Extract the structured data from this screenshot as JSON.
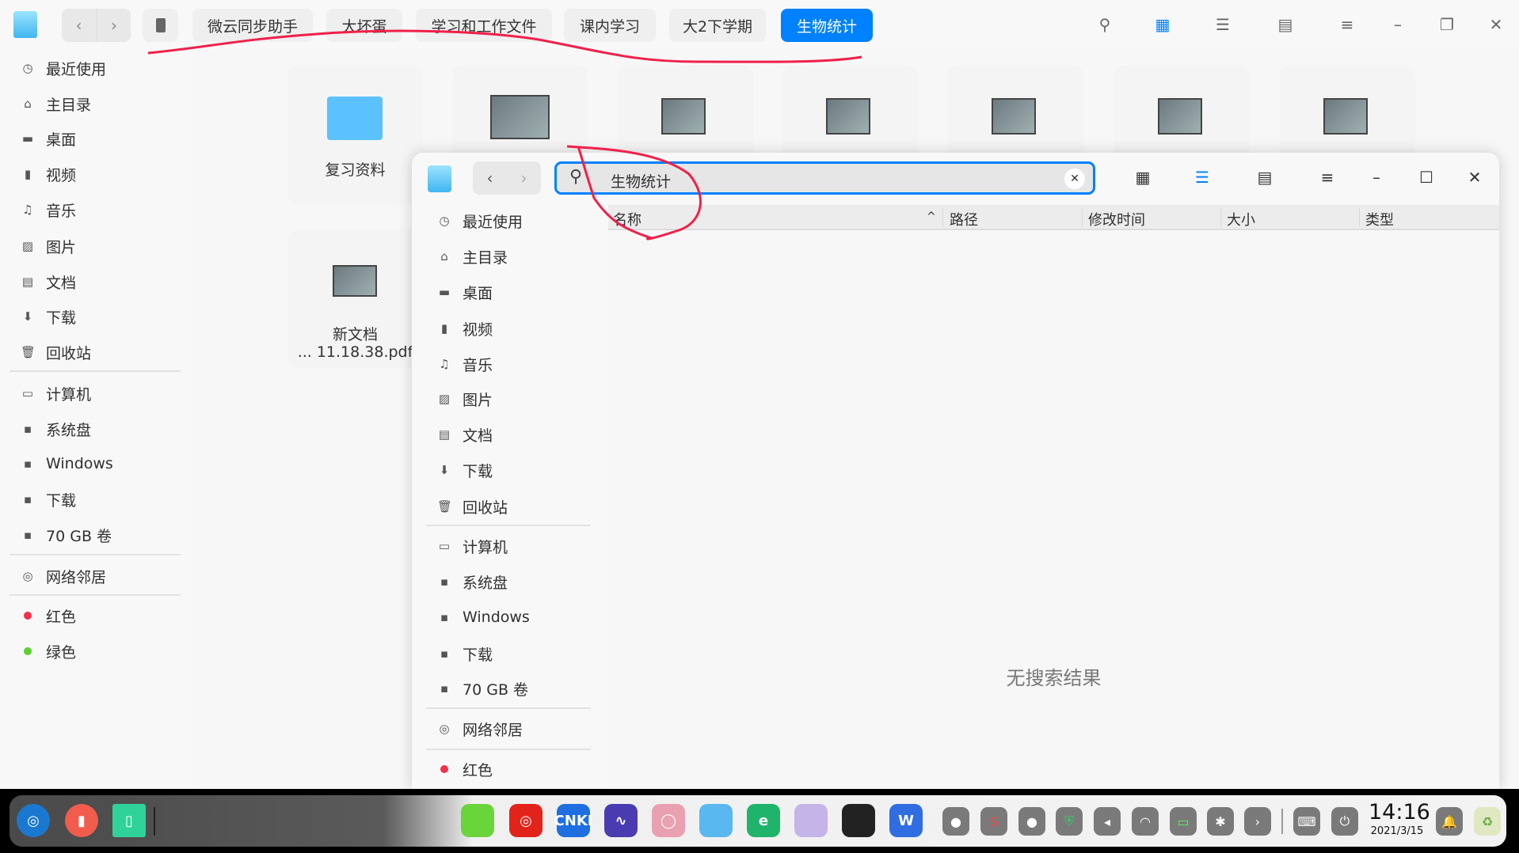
{
  "topbar": {
    "breadcrumbs": [
      "微云同步助手",
      "大坏蛋",
      "学习和工作文件",
      "课内学习",
      "大2下学期",
      "生物统计"
    ]
  },
  "sidebar": {
    "items": [
      {
        "label": "最近使用",
        "icon": "clock-icon"
      },
      {
        "label": "主目录",
        "icon": "home-icon"
      },
      {
        "label": "桌面",
        "icon": "desktop-icon"
      },
      {
        "label": "视频",
        "icon": "video-icon"
      },
      {
        "label": "音乐",
        "icon": "music-icon"
      },
      {
        "label": "图片",
        "icon": "picture-icon"
      },
      {
        "label": "文档",
        "icon": "document-icon"
      },
      {
        "label": "下载",
        "icon": "download-icon"
      },
      {
        "label": "回收站",
        "icon": "trash-icon"
      },
      {
        "label": "计算机",
        "icon": "computer-icon"
      },
      {
        "label": "系统盘",
        "icon": "disk-icon"
      },
      {
        "label": "Windows",
        "icon": "disk-icon"
      },
      {
        "label": "下载",
        "icon": "disk-icon"
      },
      {
        "label": "70 GB 卷",
        "icon": "disk-icon"
      },
      {
        "label": "网络邻居",
        "icon": "network-icon"
      },
      {
        "label": "红色",
        "icon": "tag-red",
        "color": "#f0324b"
      },
      {
        "label": "绿色",
        "icon": "tag-green",
        "color": "#5bd12d"
      }
    ]
  },
  "files": [
    {
      "label": "复习资料",
      "type": "folder"
    },
    {
      "label": "",
      "type": "image"
    },
    {
      "label": "",
      "type": "image"
    },
    {
      "label": "",
      "type": "image"
    },
    {
      "label": "",
      "type": "image"
    },
    {
      "label": "",
      "type": "image"
    },
    {
      "label": "",
      "type": "image"
    },
    {
      "label_line1": "新文档",
      "label_line2": "... 11.18.38.pdf",
      "type": "pdf"
    }
  ],
  "dialog": {
    "search_value": "生物统计",
    "columns": [
      "名称",
      "路径",
      "修改时间",
      "大小",
      "类型"
    ],
    "empty_text": "无搜索结果",
    "sidebar_items": [
      "最近使用",
      "主目录",
      "桌面",
      "视频",
      "音乐",
      "图片",
      "文档",
      "下载",
      "回收站",
      "计算机",
      "系统盘",
      "Windows",
      "下载",
      "70 GB 卷",
      "网络邻居",
      "红色"
    ]
  },
  "taskbar": {
    "time": "14:16",
    "date": "2021/3/15",
    "apps": [
      {
        "name": "wechat",
        "label": "",
        "color": "#6ad43b"
      },
      {
        "name": "netease-music",
        "label": "◎",
        "color": "#e2231a"
      },
      {
        "name": "cnki",
        "label": "CNKI",
        "color": "#1f6fe0"
      },
      {
        "name": "system-monitor",
        "label": "∿",
        "color": "#4a3bb0"
      },
      {
        "name": "settings",
        "label": "◯",
        "color": "#e9a0b0"
      },
      {
        "name": "file-manager",
        "label": "",
        "color": "#5ab8f0"
      },
      {
        "name": "edge-browser",
        "label": "e",
        "color": "#1fb46b"
      },
      {
        "name": "app-store",
        "label": "",
        "color": "#c4b4e8"
      },
      {
        "name": "qq",
        "label": "",
        "color": "#222"
      },
      {
        "name": "wps",
        "label": "W",
        "color": "#2f6de0"
      }
    ]
  },
  "accent": "#0081ff",
  "annotation_color": "#f0204a"
}
